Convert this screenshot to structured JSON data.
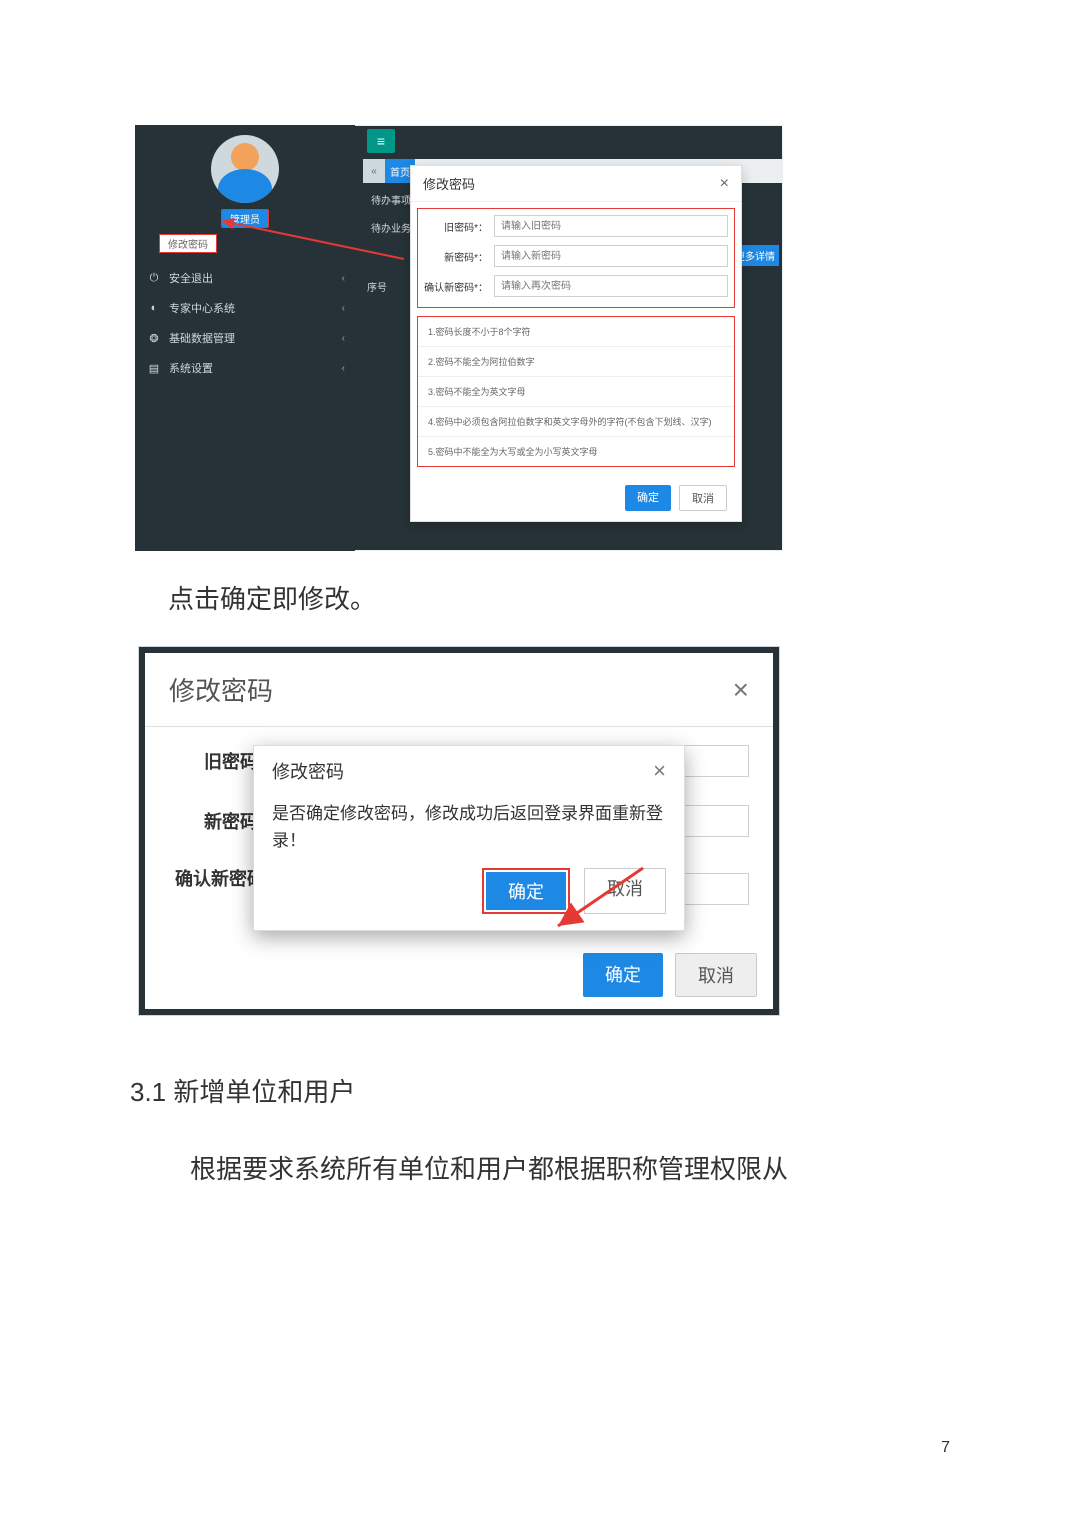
{
  "screenshot1": {
    "role_tag": "管理员",
    "change_pwd_tag": "修改密码",
    "sidebar": [
      {
        "icon": "⏻",
        "label": "安全退出",
        "chev": "‹"
      },
      {
        "icon": "◐",
        "label": "专家中心系统",
        "chev": "‹"
      },
      {
        "icon": "❂",
        "label": "基础数据管理",
        "chev": "‹"
      },
      {
        "icon": "▤",
        "label": "系统设置",
        "chev": "‹"
      }
    ],
    "menu_icon": "≡",
    "tab_back": "«",
    "tab_home": "首页",
    "left_labels": [
      "待办事项",
      "待办业务"
    ],
    "more_btn": "更多详情",
    "seq_label": "序号",
    "modal": {
      "title": "修改密码",
      "close": "×",
      "fields": [
        {
          "label": "旧密码*：",
          "ph": "请输入旧密码"
        },
        {
          "label": "新密码*：",
          "ph": "请输入新密码"
        },
        {
          "label": "确认新密码*：",
          "ph": "请输入再次密码"
        }
      ],
      "rules": [
        "1.密码长度不小于8个字符",
        "2.密码不能全为阿拉伯数字",
        "3.密码不能全为英文字母",
        "4.密码中必须包含阿拉伯数字和英文字母外的字符(不包含下划线、汉字)",
        "5.密码中不能全为大写或全为小写英文字母"
      ],
      "ok": "确定",
      "cancel": "取消"
    }
  },
  "caption": "点击确定即修改。",
  "screenshot2": {
    "title": "修改密码",
    "close": "×",
    "labels": [
      "旧密码*",
      "新密码*",
      "确认新密码*"
    ],
    "confirm": {
      "title": "修改密码",
      "close": "×",
      "message": "是否确定修改密码，修改成功后返回登录界面重新登录！",
      "ok": "确定",
      "cancel": "取消"
    },
    "outer_ok": "确定",
    "outer_cancel": "取消"
  },
  "section_title": "3.1 新增单位和用户",
  "paragraph": "根据要求系统所有单位和用户都根据职称管理权限从",
  "page_number": "7"
}
